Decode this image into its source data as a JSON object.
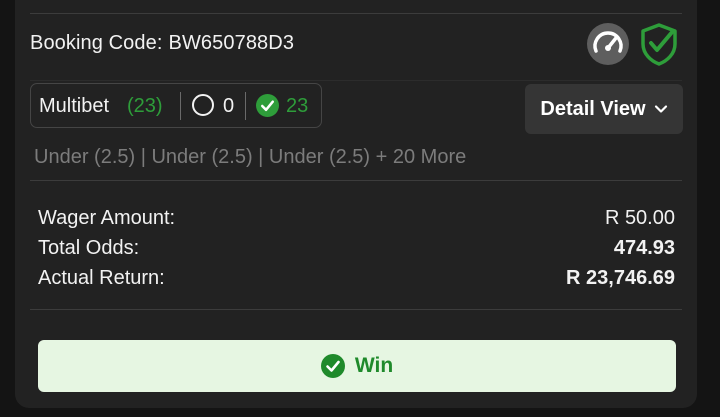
{
  "colors": {
    "background": "#141414",
    "card": "#222222",
    "accent_green": "#2e9d3a",
    "win_bg": "#e6f6e2",
    "muted_text": "#7c7c7c"
  },
  "booking": {
    "label": "Booking Code:",
    "code": "BW650788D3"
  },
  "icons": {
    "speed": "speedometer-icon",
    "shield": "shield-check-icon"
  },
  "multibet": {
    "label": "Multibet",
    "total": "(23)",
    "open_count": "0",
    "won_count": "23"
  },
  "detail_button": {
    "label": "Detail View"
  },
  "selections": {
    "summary": "Under (2.5) | Under (2.5) | Under (2.5) + 20 More"
  },
  "summary": {
    "wager_label": "Wager Amount:",
    "wager_value": "R 50.00",
    "odds_label": "Total Odds:",
    "odds_value": "474.93",
    "return_label": "Actual Return:",
    "return_value": "R 23,746.69"
  },
  "result": {
    "label": "Win"
  }
}
